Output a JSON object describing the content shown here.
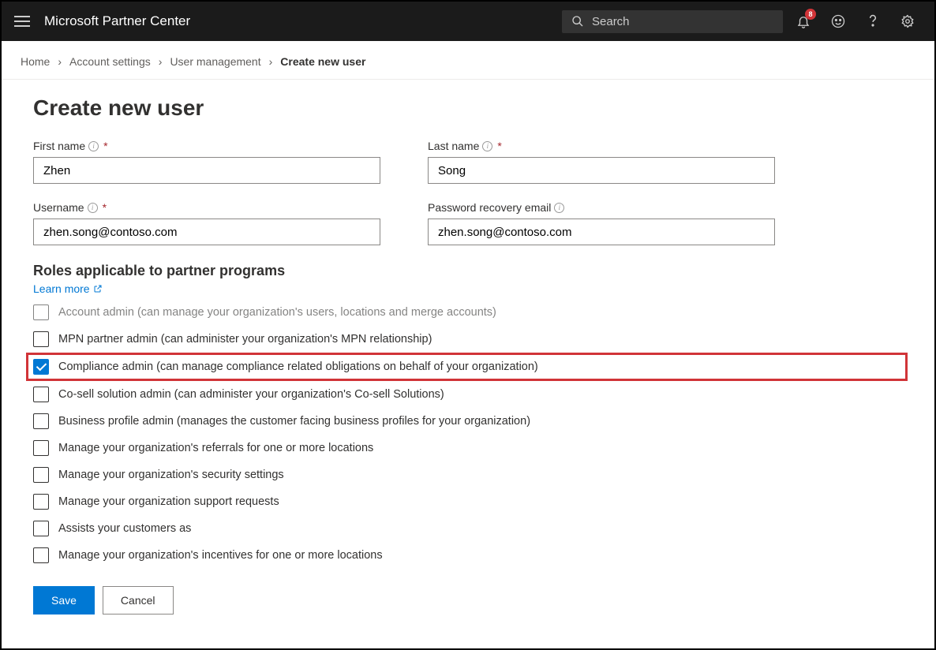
{
  "header": {
    "title": "Microsoft Partner Center",
    "search_placeholder": "Search",
    "notification_count": "8"
  },
  "breadcrumb": {
    "items": [
      {
        "label": "Home"
      },
      {
        "label": "Account settings"
      },
      {
        "label": "User management"
      }
    ],
    "current": "Create new user"
  },
  "page": {
    "title": "Create new user"
  },
  "form": {
    "first_name": {
      "label": "First name",
      "value": "Zhen",
      "required": true
    },
    "last_name": {
      "label": "Last name",
      "value": "Song",
      "required": true
    },
    "username": {
      "label": "Username",
      "value": "zhen.song@contoso.com",
      "required": true
    },
    "recovery_email": {
      "label": "Password recovery email",
      "value": "zhen.song@contoso.com",
      "required": false
    }
  },
  "roles_section": {
    "title": "Roles applicable to partner programs",
    "learn_more": "Learn more"
  },
  "roles": [
    {
      "label": "Account admin (can manage your organization's users, locations and merge accounts)",
      "checked": false,
      "truncated": true
    },
    {
      "label": "MPN partner admin (can administer your organization's MPN relationship)",
      "checked": false
    },
    {
      "label": "Compliance admin (can manage compliance related obligations on behalf of your organization)",
      "checked": true,
      "highlighted": true
    },
    {
      "label": "Co-sell solution admin (can administer your organization's Co-sell Solutions)",
      "checked": false
    },
    {
      "label": "Business profile admin (manages the customer facing business profiles for your organization)",
      "checked": false
    },
    {
      "label": "Manage your organization's referrals for one or more locations",
      "checked": false
    },
    {
      "label": "Manage your organization's security settings",
      "checked": false
    },
    {
      "label": "Manage your organization support requests",
      "checked": false
    },
    {
      "label": "Assists your customers as",
      "checked": false
    },
    {
      "label": "Manage your organization's incentives for one or more locations",
      "checked": false
    }
  ],
  "buttons": {
    "save": "Save",
    "cancel": "Cancel"
  }
}
